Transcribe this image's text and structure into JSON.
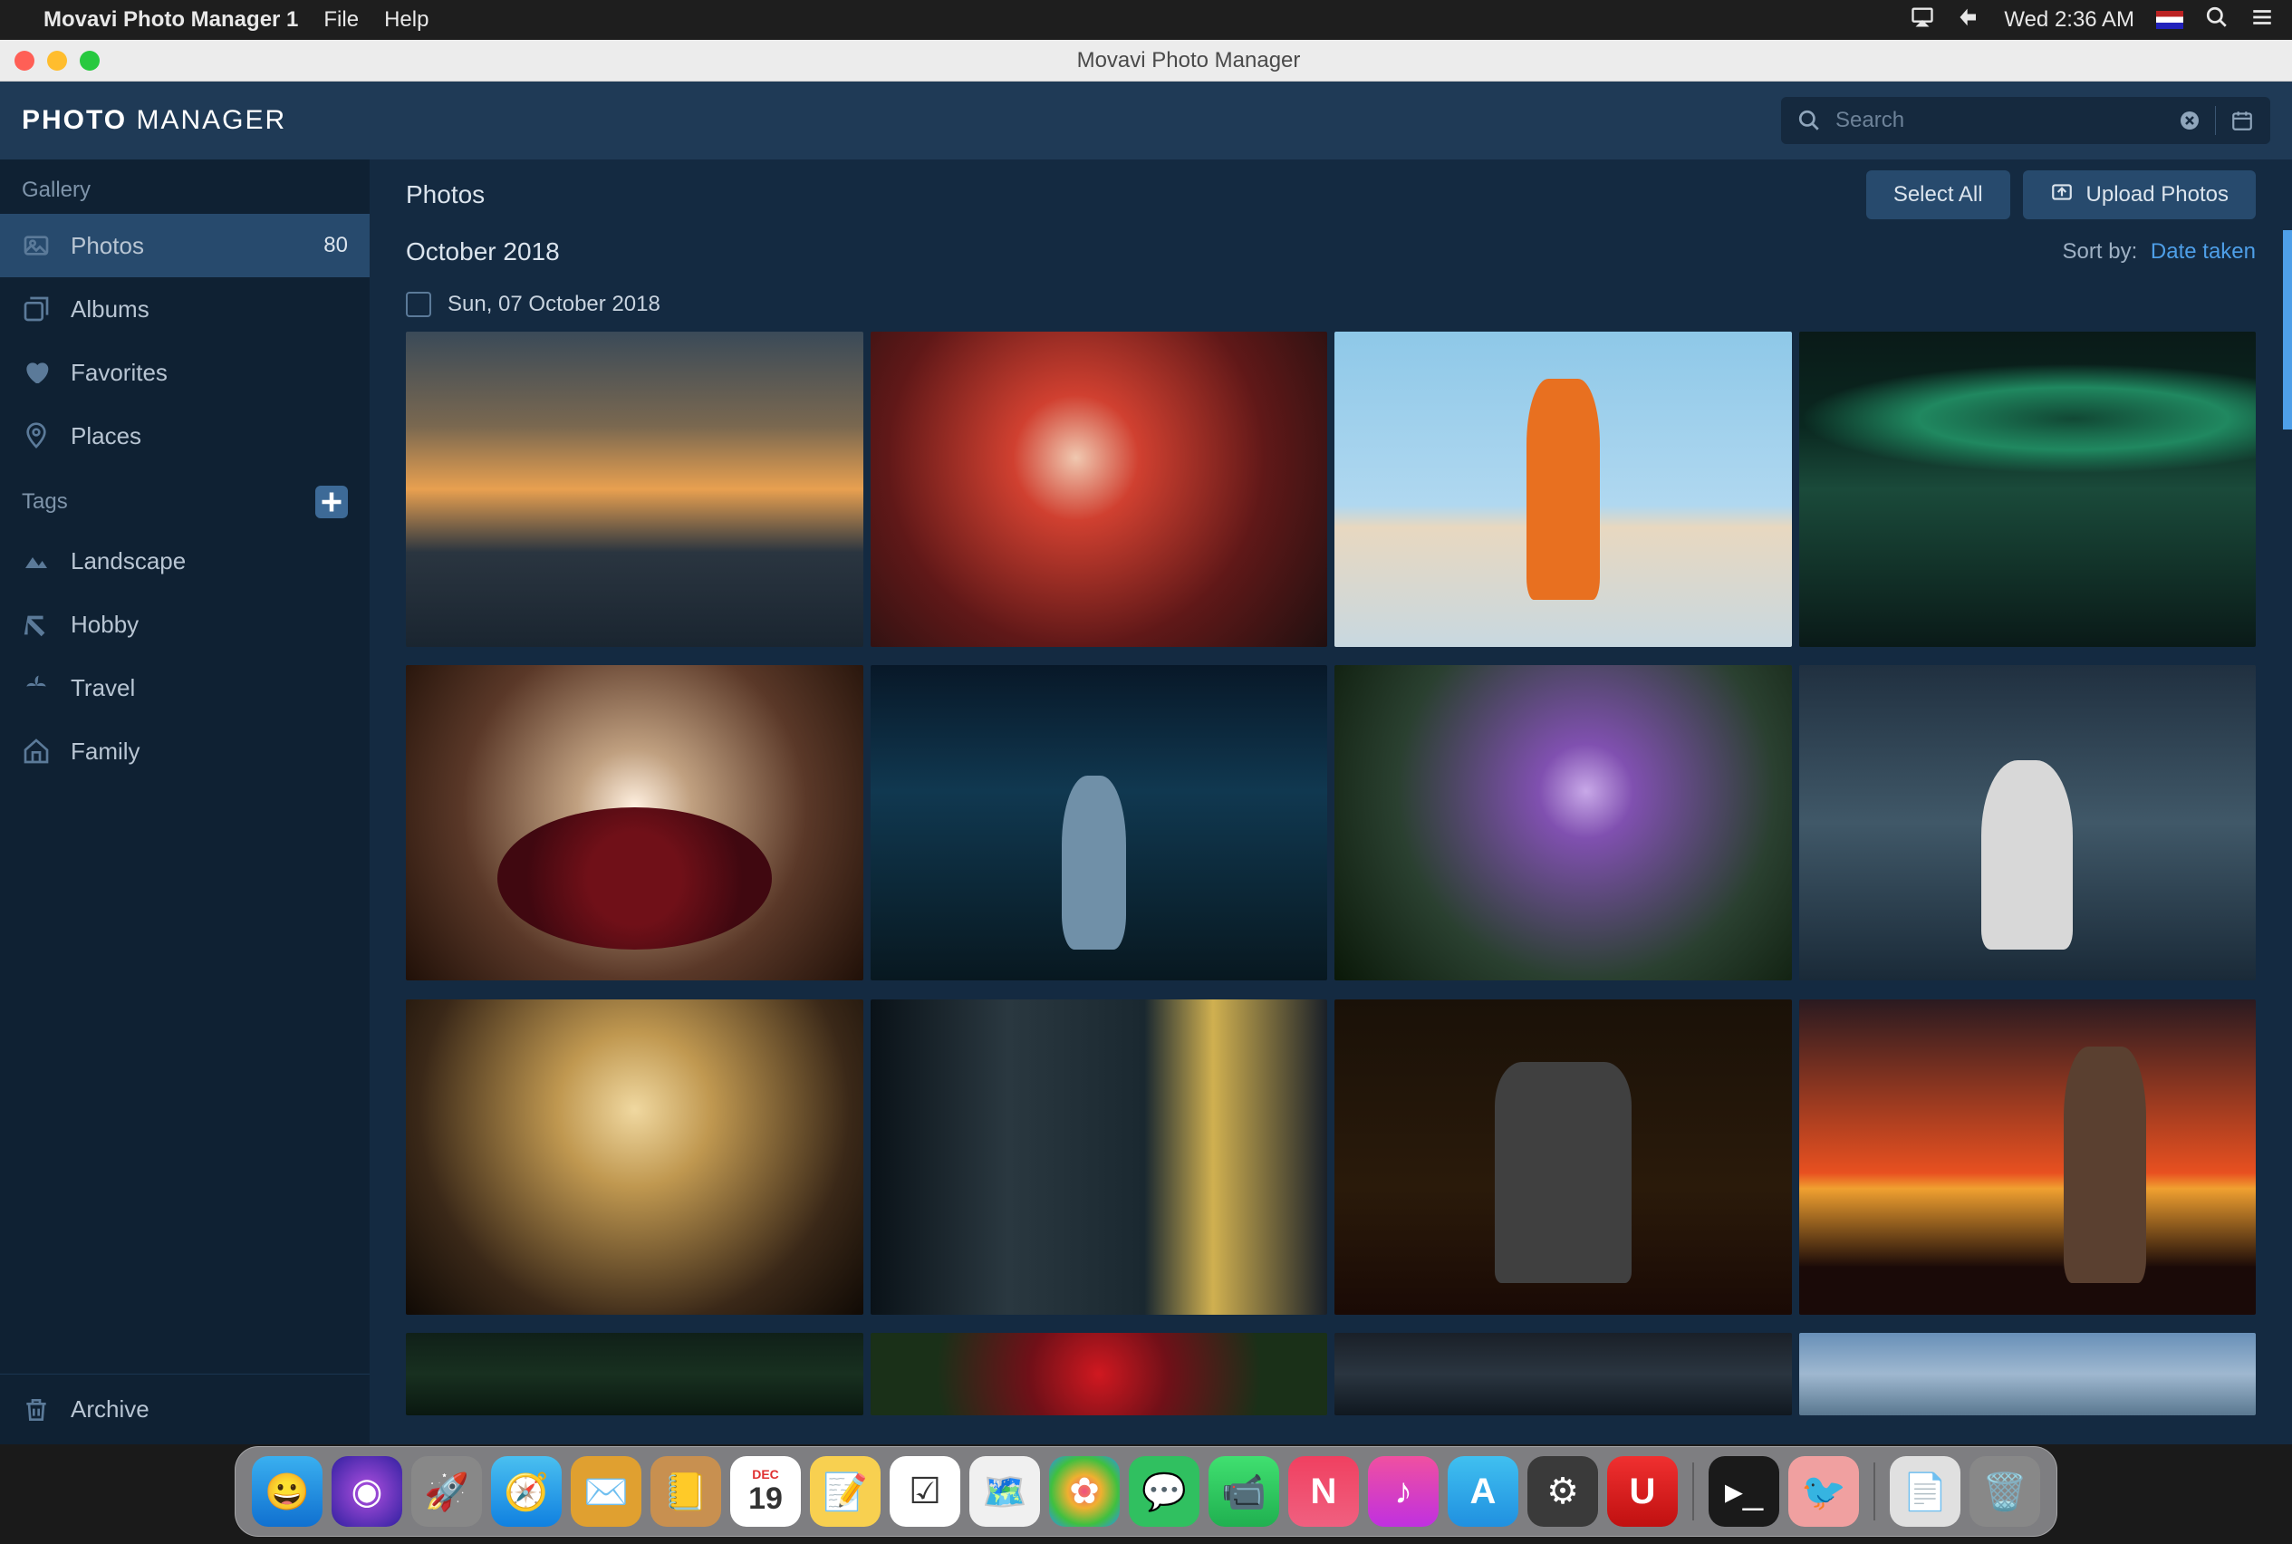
{
  "menubar": {
    "app_name": "Movavi Photo Manager 1",
    "menus": [
      "File",
      "Help"
    ],
    "clock": "Wed 2:36 AM"
  },
  "window": {
    "title": "Movavi Photo Manager"
  },
  "header": {
    "logo_bold": "PHOTO",
    "logo_light": " MANAGER",
    "search_placeholder": "Search"
  },
  "sidebar": {
    "gallery_label": "Gallery",
    "items": [
      {
        "label": "Photos",
        "count": "80"
      },
      {
        "label": "Albums"
      },
      {
        "label": "Favorites"
      },
      {
        "label": "Places"
      }
    ],
    "tags_label": "Tags",
    "tags": [
      {
        "label": "Landscape"
      },
      {
        "label": "Hobby"
      },
      {
        "label": "Travel"
      },
      {
        "label": "Family"
      }
    ],
    "archive_label": "Archive"
  },
  "main": {
    "page_title": "Photos",
    "select_all": "Select All",
    "upload": "Upload Photos",
    "month": "October 2018",
    "sort_label": "Sort by:",
    "sort_value": "Date taken",
    "date_group": "Sun, 07 October 2018"
  },
  "dock": {
    "cal_day": "19",
    "cal_month": "DEC"
  }
}
